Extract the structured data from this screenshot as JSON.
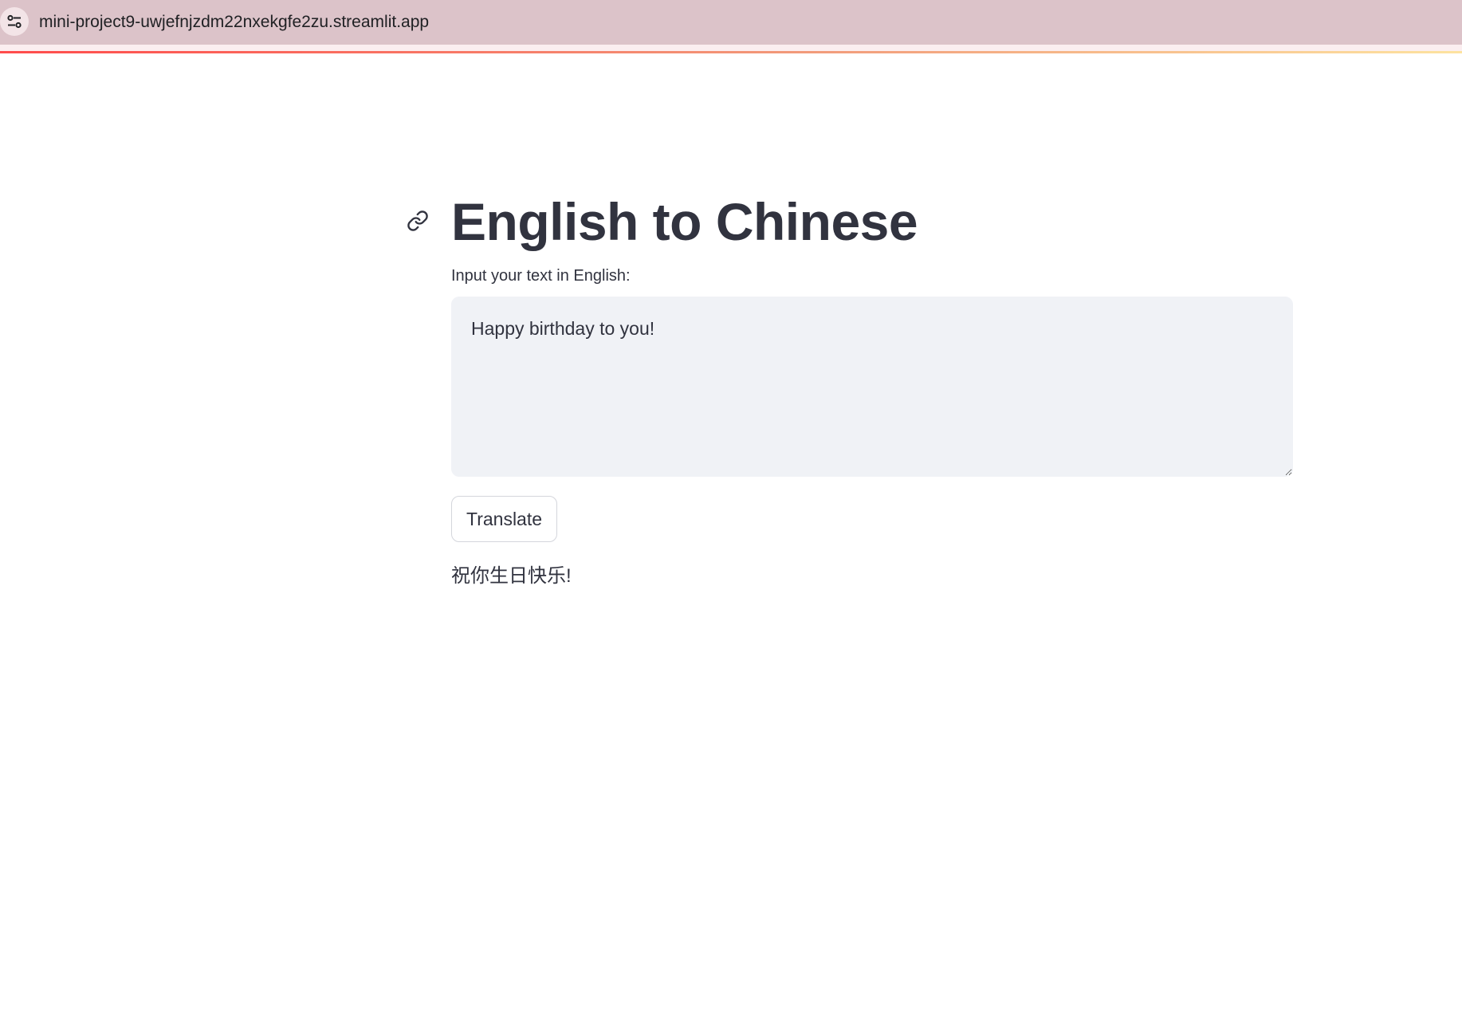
{
  "browser": {
    "url": "mini-project9-uwjefnjzdm22nxekgfe2zu.streamlit.app",
    "site_info_icon": "tune-icon"
  },
  "colors": {
    "accent_start": "#ff4b4b",
    "accent_end": "#fde3a0",
    "browser_bar": "#dcc3c9",
    "text": "#31333f",
    "input_bg": "#f0f2f6"
  },
  "page": {
    "anchor_icon": "link-icon",
    "title": "English to Chinese",
    "input": {
      "label": "Input your text in English:",
      "value": "Happy birthday to you!"
    },
    "translate_button_label": "Translate",
    "result": "祝你生日快乐!"
  }
}
